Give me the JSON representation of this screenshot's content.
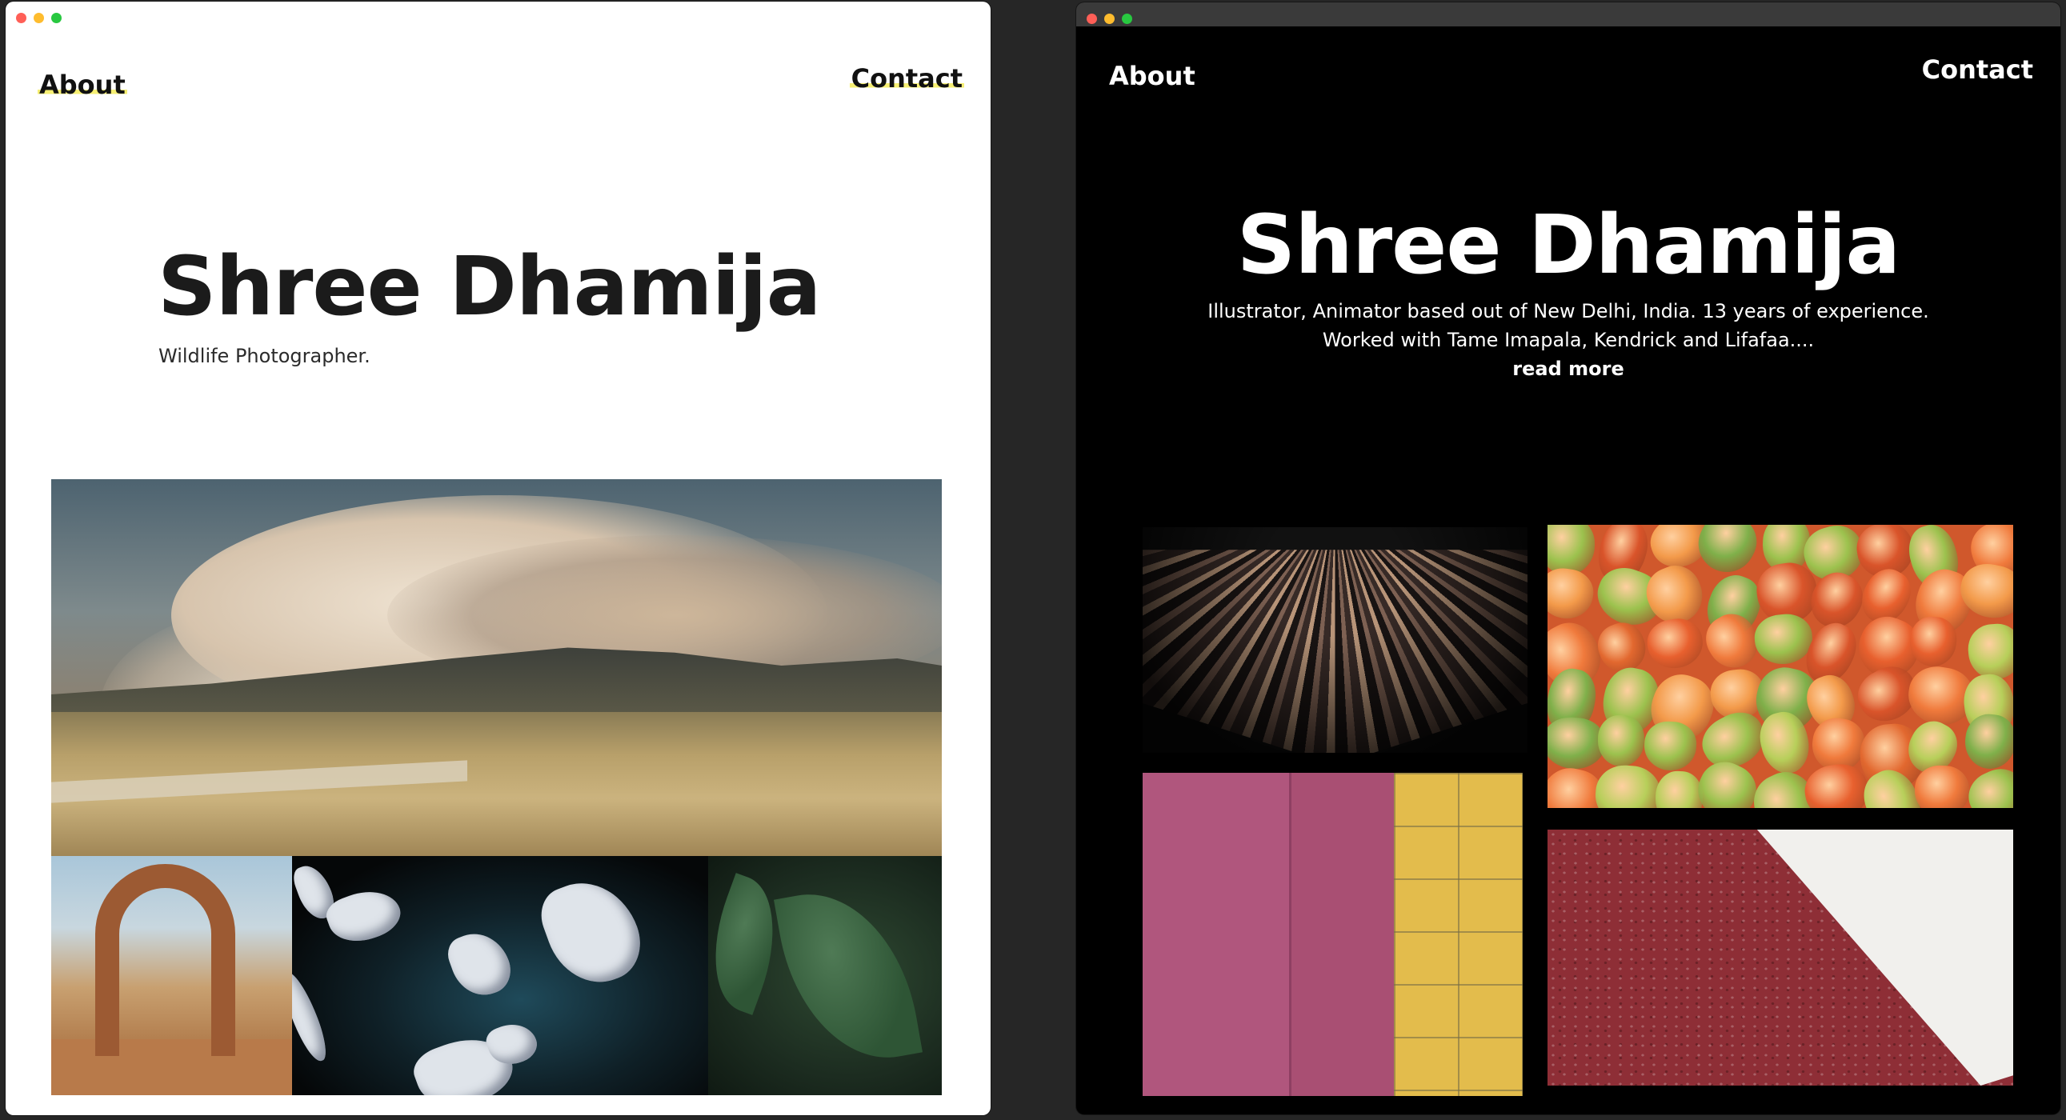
{
  "left_window": {
    "nav": {
      "about": "About",
      "contact": "Contact"
    },
    "hero": {
      "name": "Shree Dhamija",
      "tagline": "Wildlife Photographer."
    },
    "accent_color": "#f6ef73",
    "photos": [
      "smoke-plume-desert-photo",
      "rock-arch-photo",
      "crumpled-paper-photo",
      "wet-leaves-photo"
    ]
  },
  "right_window": {
    "nav": {
      "about": "About",
      "contact": "Contact"
    },
    "hero": {
      "name": "Shree Dhamija",
      "bio_line1": "Illustrator, Animator based out of New Delhi, India. 13 years of experience.",
      "bio_line2": "Worked with Tame Imapala, Kendrick and Lifafaa....",
      "read_more": "read more"
    },
    "photos": [
      "light-streaks-photo",
      "orange-lanterns-photo",
      "pink-wall-yellow-tiles-photo",
      "red-asphalt-white-stripe-photo"
    ]
  }
}
